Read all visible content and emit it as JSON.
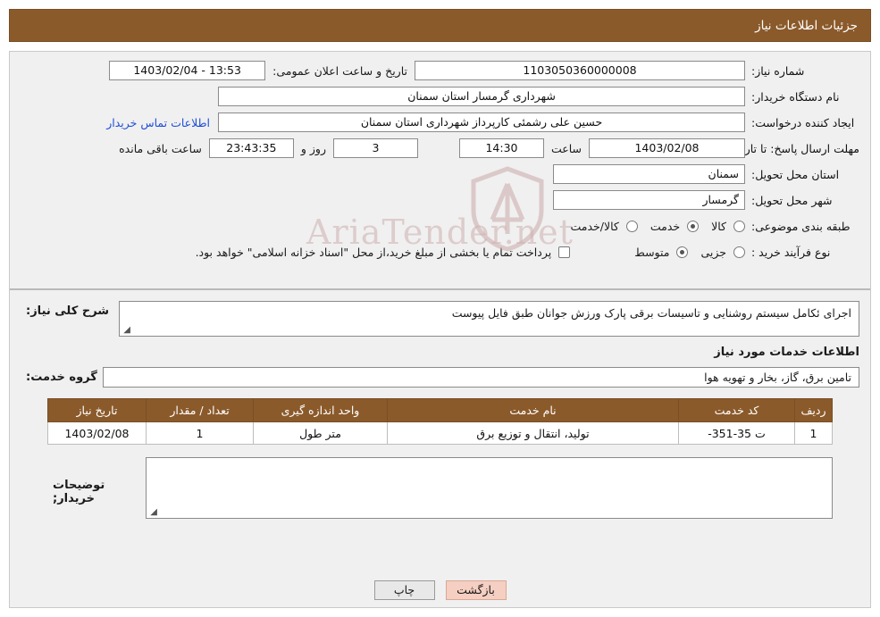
{
  "header": {
    "title": "جزئیات اطلاعات نیاز"
  },
  "form": {
    "need_number_label": "شماره نیاز:",
    "need_number_value": "1103050360000008",
    "public_announce_label": "تاریخ و ساعت اعلان عمومی:",
    "public_announce_value": "13:53 - 1403/02/04",
    "buyer_org_label": "نام دستگاه خریدار:",
    "buyer_org_value": "شهرداری گرمسار استان سمنان",
    "creator_label": "ایجاد کننده درخواست:",
    "creator_value": "حسین علی رشمئی کارپرداز شهرداری استان سمنان",
    "contact_link": "اطلاعات تماس خریدار",
    "deadline_label": "مهلت ارسال پاسخ: تا تاریخ:",
    "deadline_date": "1403/02/08",
    "hour_label": "ساعت",
    "deadline_time": "14:30",
    "days_value": "3",
    "days_label": "روز و",
    "remaining_time": "23:43:35",
    "remaining_label": "ساعت باقی مانده",
    "province_label": "استان محل تحویل:",
    "province_value": "سمنان",
    "city_label": "شهر محل تحویل:",
    "city_value": "گرمسار",
    "category_label": "طبقه بندی موضوعی:",
    "category_options": [
      {
        "label": "کالا",
        "selected": false
      },
      {
        "label": "خدمت",
        "selected": true
      },
      {
        "label": "کالا/خدمت",
        "selected": false
      }
    ],
    "process_label": "نوع فرآیند خرید :",
    "process_options": [
      {
        "label": "جزیی",
        "selected": false
      },
      {
        "label": "متوسط",
        "selected": true
      }
    ],
    "payment_note": "پرداخت تمام یا بخشی از مبلغ خرید،از محل \"اسناد خزانه اسلامی\" خواهد بود.",
    "payment_checked": false
  },
  "watermark": {
    "text": "AriaTender.net"
  },
  "need": {
    "summary_label": "شرح کلی نیاز:",
    "summary_value": "اجرای ئکامل سیستم روشنایی و تاسیسات برقی پارک ورزش جوانان طبق فایل پیوست",
    "services_heading": "اطلاعات خدمات مورد نیاز",
    "service_group_label": "گروه خدمت:",
    "service_group_value": "تامین برق، گاز، بخار و تهویه هوا"
  },
  "table": {
    "headers": [
      "ردیف",
      "کد خدمت",
      "نام خدمت",
      "واحد اندازه گیری",
      "تعداد / مقدار",
      "تاریخ نیاز"
    ],
    "rows": [
      {
        "row": "1",
        "code": "ت 35-351-",
        "name": "تولید، انتقال و توزیع برق",
        "unit": "متر طول",
        "qty": "1",
        "date": "1403/02/08"
      }
    ]
  },
  "buyer_notes": {
    "label": "توضیحات خریدار;",
    "value": ""
  },
  "footer": {
    "print_label": "چاپ",
    "back_label": "بازگشت"
  }
}
